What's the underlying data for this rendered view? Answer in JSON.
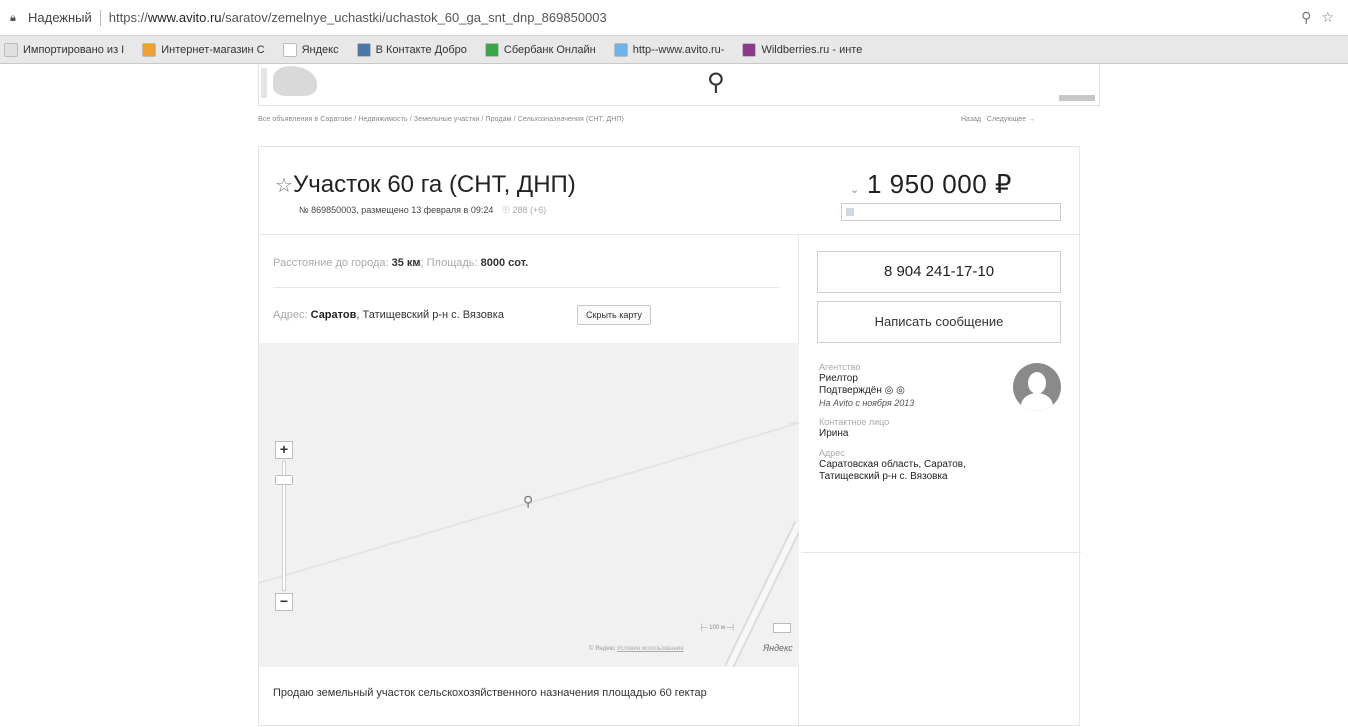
{
  "browser": {
    "secure_label": "Надежный",
    "url_prefix": "https://",
    "url_host": "www.avito.ru",
    "url_path": "/saratov/zemelnye_uchastki/uchastok_60_ga_snt_dnp_869850003",
    "bookmarks": [
      {
        "label": "Импортировано из I",
        "color": "#e0e0e0"
      },
      {
        "label": "Интернет-магазин C",
        "color": "#f0a030"
      },
      {
        "label": "Яндекс",
        "color": "#ffffff"
      },
      {
        "label": "В Контакте  Добро",
        "color": "#4a76a8"
      },
      {
        "label": "Сбербанк Онлайн",
        "color": "#3aa648"
      },
      {
        "label": "http--www.avito.ru-",
        "color": "#6db3e8"
      },
      {
        "label": "Wildberries.ru - инте",
        "color": "#8c3a8c"
      }
    ]
  },
  "breadcrumb": "Все объявления в Саратове / Недвижимость / Земельные участки / Продам / Сельхозназначения (СНТ, ДНП)",
  "breadcrumb_nav": {
    "back": "Назад",
    "next": "Следующее →"
  },
  "listing": {
    "title": "Участок 60 га (СНТ, ДНП)",
    "meta": "№ 869850003, размещено 13 февраля в 09:24",
    "views": "☉ 288 (+6)",
    "price": "1 950 000 ₽",
    "params": {
      "distance_label": "Расстояние до города: ",
      "distance_value": "35 км",
      "area_label": "; Площадь: ",
      "area_value": "8000 сот."
    },
    "address": {
      "label": "Адрес: ",
      "city": "Саратов",
      "rest": ", Татищевский р-н с. Вязовка"
    },
    "hide_map_label": "Скрыть карту",
    "map": {
      "scale_text": "├─ 100 м ─┤",
      "copyright": "© Яндекс ",
      "terms": "Условия использования",
      "logo": "Яндекс"
    },
    "description": "Продаю земельный участок сельскохозяйственного назначения площадью 60 гектар"
  },
  "seller": {
    "phone": "8 904 241-17-10",
    "message_button": "Написать сообщение",
    "agency_label": "Агентство",
    "agency_name": "Риелтор",
    "verified": "Подтверждён ◎ ◎",
    "since": "На Avito с ноября 2013",
    "contact_label": "Контактное лицо",
    "contact_name": "Ирина",
    "address_label": "Адрес",
    "address_value": "Саратовская область, Саратов, Татищевский р-н с. Вязовка"
  }
}
